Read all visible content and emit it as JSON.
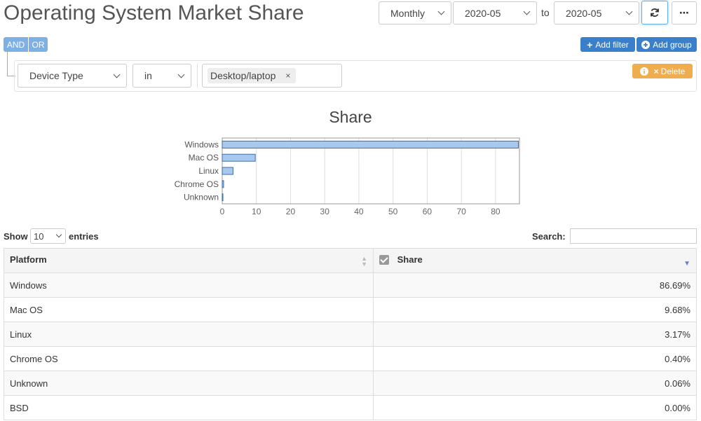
{
  "header": {
    "title": "Operating System Market Share",
    "granularity": "Monthly",
    "date_from": "2020-05",
    "to_label": "to",
    "date_to": "2020-05",
    "refresh_icon": "refresh-icon",
    "more_icon": "ellipsis-icon"
  },
  "filter": {
    "and_label": "AND",
    "or_label": "OR",
    "add_filter_label": "Add filter",
    "add_group_label": "Add group",
    "field": "Device Type",
    "operator": "in",
    "value_tag": "Desktop/laptop",
    "delete_label": "Delete"
  },
  "colors": {
    "primary": "#3a7fc9",
    "logic": "#7fb0e3",
    "warning": "#f0ad4e",
    "bar_fill": "#a8c8ee",
    "bar_stroke": "#3d6ea8"
  },
  "chart_data": {
    "type": "bar",
    "orientation": "horizontal",
    "title": "Share",
    "categories": [
      "Windows",
      "Mac OS",
      "Linux",
      "Chrome OS",
      "Unknown"
    ],
    "values": [
      86.69,
      9.68,
      3.17,
      0.4,
      0.06
    ],
    "xlim": [
      0,
      87
    ],
    "xticks": [
      0,
      10,
      20,
      30,
      40,
      50,
      60,
      70,
      80
    ],
    "grid": true
  },
  "controls": {
    "show_label": "Show",
    "entries_value": "10",
    "entries_label": "entries",
    "search_label": "Search:"
  },
  "table": {
    "columns": [
      "Platform",
      "Share"
    ],
    "rows": [
      {
        "platform": "Windows",
        "share": "86.69%"
      },
      {
        "platform": "Mac OS",
        "share": "9.68%"
      },
      {
        "platform": "Linux",
        "share": "3.17%"
      },
      {
        "platform": "Chrome OS",
        "share": "0.40%"
      },
      {
        "platform": "Unknown",
        "share": "0.06%"
      },
      {
        "platform": "BSD",
        "share": "0.00%"
      }
    ]
  }
}
